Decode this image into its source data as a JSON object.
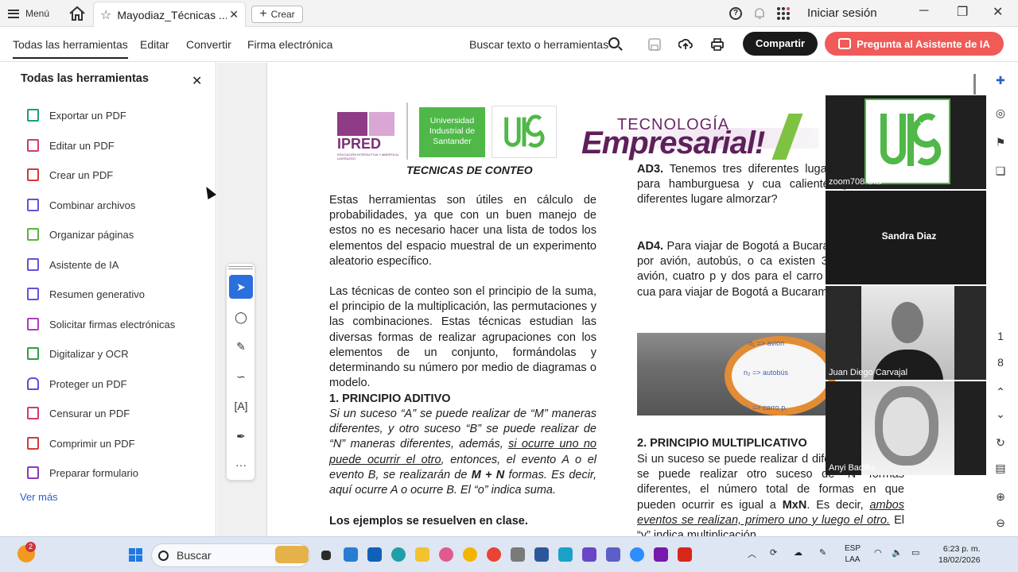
{
  "titlebar": {
    "menu_label": "Menú",
    "tab_title": "Mayodiaz_Técnicas ...",
    "create_label": "Crear",
    "signin_label": "Iniciar sesión"
  },
  "toolbar": {
    "items": [
      "Todas las herramientas",
      "Editar",
      "Convertir",
      "Firma electrónica"
    ],
    "search_label": "Buscar texto o herramientas",
    "share_label": "Compartir",
    "ai_label": "Pregunta al Asistente de IA"
  },
  "left_panel": {
    "title": "Todas las herramientas",
    "tools": [
      {
        "label": "Exportar un PDF",
        "icon": "export-pdf-icon",
        "color": "#1a9e78"
      },
      {
        "label": "Editar un PDF",
        "icon": "edit-pdf-icon",
        "color": "#d23a6b"
      },
      {
        "label": "Crear un PDF",
        "icon": "create-pdf-icon",
        "color": "#d23a3a"
      },
      {
        "label": "Combinar archivos",
        "icon": "combine-files-icon",
        "color": "#6a4fd8"
      },
      {
        "label": "Organizar páginas",
        "icon": "organize-pages-icon",
        "color": "#5cb23b"
      },
      {
        "label": "Asistente de IA",
        "icon": "ai-assistant-icon",
        "color": "#6a4fd8"
      },
      {
        "label": "Resumen generativo",
        "icon": "generative-summary-icon",
        "color": "#6a4fd8"
      },
      {
        "label": "Solicitar firmas electrónicas",
        "icon": "request-signatures-icon",
        "color": "#b03bbd"
      },
      {
        "label": "Digitalizar y OCR",
        "icon": "scan-ocr-icon",
        "color": "#2f9e3f"
      },
      {
        "label": "Proteger un PDF",
        "icon": "protect-pdf-icon",
        "color": "#5a4fd8"
      },
      {
        "label": "Censurar un PDF",
        "icon": "redact-pdf-icon",
        "color": "#d23a6b"
      },
      {
        "label": "Comprimir un PDF",
        "icon": "compress-pdf-icon",
        "color": "#d23a3a"
      },
      {
        "label": "Preparar formulario",
        "icon": "prepare-form-icon",
        "color": "#8a3bbd"
      }
    ],
    "more_label": "Ver más"
  },
  "document": {
    "logo_ipred": "IPRED",
    "logo_ipred_small": "EDUCACIÓN INTERACTIVA Y ABIERTA AL LIDERAZGO",
    "logo_uis_text": "Universidad Industrial de Santander",
    "logo_tecn_top": "TECNOLOGÍA",
    "logo_tecn_big": "Empresarial!",
    "heading": "TECNICAS DE CONTEO",
    "p1": "Estas herramientas son útiles en cálculo de probabilidades, ya que con un buen manejo de estos no es necesario hacer una lista de todos los elementos del espacio muestral de un experimento aleatorio específico.",
    "p2": "Las técnicas de conteo son el principio de la suma, el principio de la multiplicación, las permutaciones y las combinaciones. Estas técnicas estudian las diversas formas de realizar agrupaciones con los elementos de un conjunto, formándolas y determinando su número por medio de diagramas o modelo.",
    "h1": "1. PRINCIPIO ADITIVO",
    "p3a": "Si un suceso “A” se puede realizar de “M” maneras diferentes, y otro suceso “B” se puede realizar de “N” maneras diferentes, además, ",
    "p3u": "si ocurre uno no puede ocurrir el otro",
    "p3b": ", entonces, el evento A o el evento B, se realizarán de ",
    "p3bold": "M + N",
    "p3c": " formas. Es decir, aquí ocurre A o ocurre B. El “o” indica suma.",
    "p4": "Los ejemplos se resuelven en clase.",
    "ad3_label": "AD3.",
    "ad3": " Tenemos tres diferentes lugares pizza; dos para hamburguesa y cua caliente. ¿A cuántos diferentes lugare almorzar?",
    "ad4_label": "AD4.",
    "ad4": " Para viajar de Bogotá a Bucaram puede optar por avión, autobús, o ca existen 3 rutas para el avión, cuatro p y dos para el carro particular. ¿De cua para viajar de Bogotá a Bucaramanga",
    "ring_labels": [
      "n₁ => avión",
      "n₂ => autobús",
      "n₃ => carro p."
    ],
    "h2": "2. PRINCIPIO MULTIPLICATIVO",
    "p5": "Si un suceso se puede realizar d diferentes y luego se puede realizar otro suceso de “N” formas diferentes, el número total de formas en que pueden ocurrir es igual a ",
    "p5bold": "MxN",
    "p5b": ". Es decir, ",
    "p5u": "ambos eventos se realizan, primero uno y luego el otro.",
    "p5c": " El “y” indica multiplicación."
  },
  "participants": [
    {
      "name": "zoom708 UIS"
    },
    {
      "name": "Sandra Diaz"
    },
    {
      "name": "Juan Diego Carvajal"
    },
    {
      "name": "Anyi Badillo"
    }
  ],
  "page_numbers": [
    "1",
    "8"
  ],
  "taskbar": {
    "search_label": "Buscar",
    "badge_count": "2",
    "lang_top": "ESP",
    "lang_bottom": "LAA",
    "time": "6:23 p. m.",
    "date": "18/02/2026"
  }
}
